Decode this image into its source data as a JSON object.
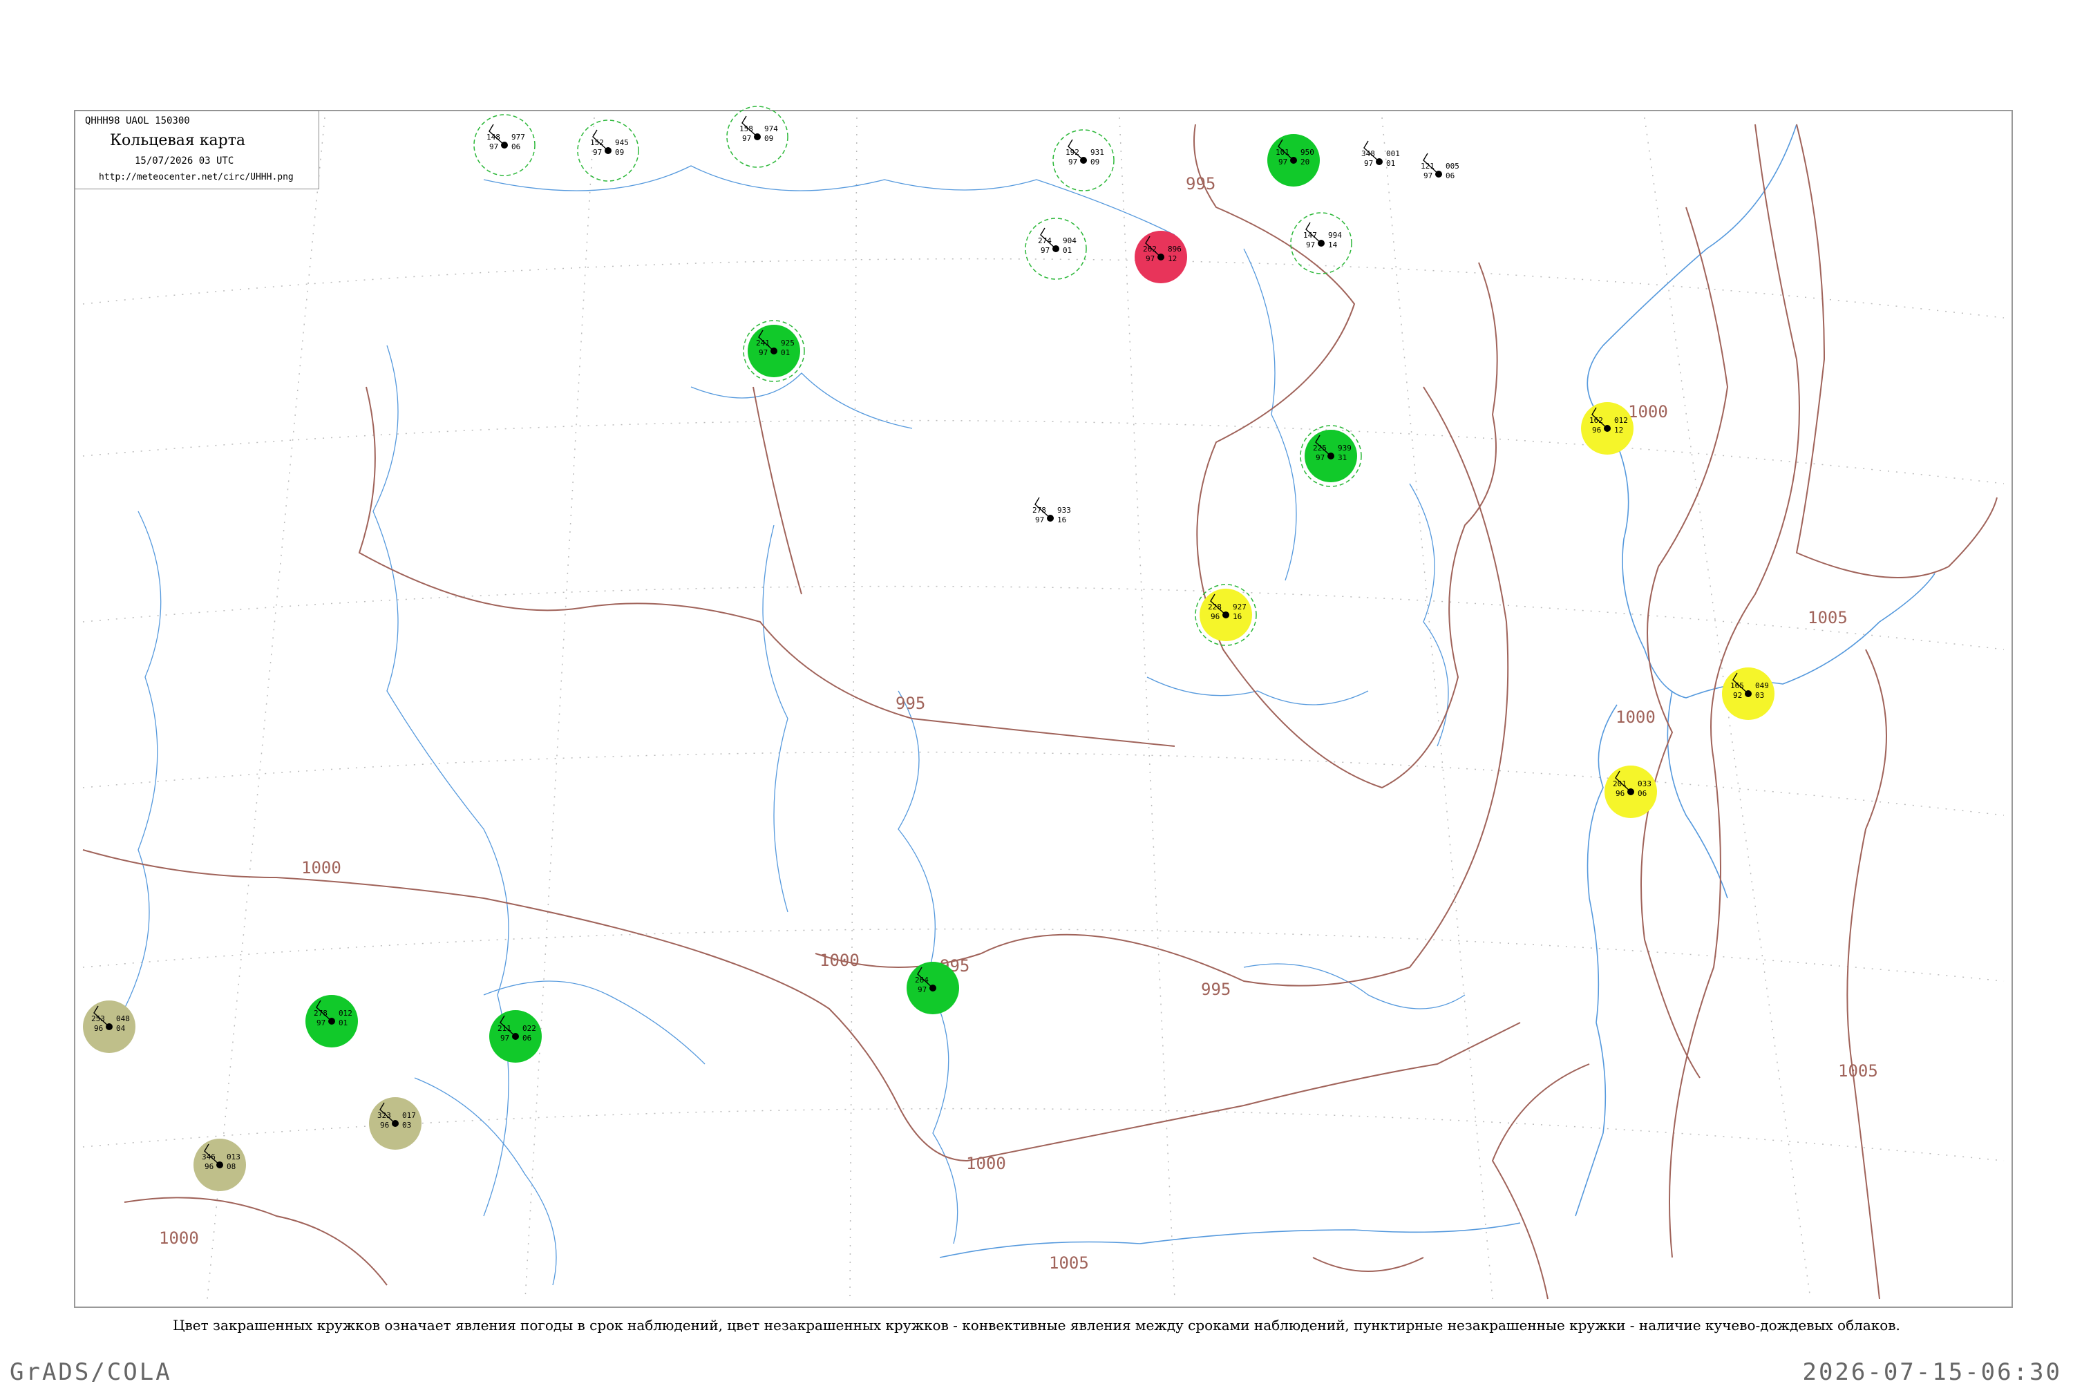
{
  "header": {
    "code": "QHHH98  UAOL  150300",
    "title": "Кольцевая карта",
    "date": "15/07/2026 03 UTC",
    "url": "http://meteocenter.net/circ/UHHH.png"
  },
  "caption": "Цвет закрашенных кружков означает явления погоды в срок наблюдений, цвет незакрашенных кружков - конвективные явления между сроками наблюдений, пунктирные незакрашенные кружки - наличие кучево-дождевых облаков.",
  "footer": {
    "left": "GrADS/COLA",
    "right": "2026-07-15-06:30"
  },
  "colors": {
    "rain": "#11c92a",
    "thunder": "#e8345a",
    "fog_drizzle": "#f5f52a",
    "mist": "#bfbf8a",
    "cb_ring": "#2db83a",
    "isobar": "#a0635a",
    "river": "#5599dd"
  },
  "isobar_labels": [
    "995",
    "995",
    "995",
    "995",
    "1000",
    "1000",
    "1000",
    "1000",
    "1000",
    "1000",
    "1005",
    "1005",
    "1005"
  ],
  "stations": [
    {
      "id": "31168",
      "p": "148",
      "t": "977",
      "d": "97",
      "v": "06",
      "fill": "none",
      "cb": true
    },
    {
      "id": "31004",
      "p": "152",
      "t": "945",
      "d": "97",
      "v": "09",
      "fill": "none",
      "cb": true
    },
    {
      "id": "24959",
      "p": "158",
      "t": "974",
      "d": "97",
      "v": "09",
      "fill": "none",
      "cb": true
    },
    {
      "id": "31329",
      "p": "192",
      "t": "931",
      "d": "97",
      "v": "09",
      "fill": "none",
      "cb": true
    },
    {
      "id": "31770",
      "p": "101",
      "t": "950",
      "d": "97",
      "v": "20",
      "fill": "rain",
      "cb": false
    },
    {
      "id": "31369",
      "p": "348",
      "t": "001",
      "d": "97",
      "v": "01",
      "fill": "none",
      "cb": false
    },
    {
      "id": "31532",
      "p": "274",
      "t": "904",
      "d": "97",
      "v": "01",
      "fill": "none",
      "cb": true
    },
    {
      "id": "31594",
      "p": "262",
      "t": "896",
      "d": "97",
      "v": "12",
      "fill": "thunder",
      "cb": false
    },
    {
      "id": "31736",
      "p": "147",
      "t": "994",
      "d": "97",
      "v": "14",
      "fill": "none",
      "cb": true
    },
    {
      "id": "31735",
      "p": "121",
      "t": "005",
      "d": "97",
      "v": "06",
      "fill": "none",
      "cb": false
    },
    {
      "id": "30854",
      "p": "278",
      "t": "933",
      "d": "97",
      "v": "16",
      "fill": "none",
      "cb": false
    },
    {
      "id": "30965",
      "p": "241",
      "t": "925",
      "d": "97",
      "v": "01",
      "fill": "rain",
      "cb": true
    },
    {
      "id": "31915",
      "p": "162",
      "t": "012",
      "d": "96",
      "v": "12",
      "fill": "fog_drizzle",
      "cb": false
    },
    {
      "id": "31989",
      "p": "165",
      "t": "049",
      "d": "92",
      "v": "03",
      "fill": "fog_drizzle",
      "cb": false
    },
    {
      "id": "32061",
      "p": "201",
      "t": "033",
      "d": "96",
      "v": "06",
      "fill": "fog_drizzle",
      "cb": false
    },
    {
      "id": "31168b",
      "p": "228",
      "t": "927",
      "d": "96",
      "v": "16",
      "fill": "fog_drizzle",
      "cb": true
    },
    {
      "id": "30823",
      "p": "253",
      "t": "048",
      "d": "96",
      "v": "04",
      "fill": "mist",
      "cb": false
    },
    {
      "id": "30949",
      "p": "323",
      "t": "017",
      "d": "96",
      "v": "03",
      "fill": "mist",
      "cb": false
    },
    {
      "id": "30971",
      "p": "346",
      "t": "013",
      "d": "96",
      "v": "08",
      "fill": "mist",
      "cb": false
    },
    {
      "id": "50353",
      "p": "264",
      "t": "",
      "d": "97",
      "v": "",
      "fill": "rain",
      "cb": false
    },
    {
      "id": "30758",
      "p": "278",
      "t": "012",
      "d": "97",
      "v": "01",
      "fill": "rain",
      "cb": false
    },
    {
      "id": "30879",
      "p": "211",
      "t": "022",
      "d": "97",
      "v": "06",
      "fill": "rain",
      "cb": false
    },
    {
      "id": "31088",
      "p": "225",
      "t": "939",
      "d": "97",
      "v": "31",
      "fill": "rain",
      "cb": true
    }
  ]
}
